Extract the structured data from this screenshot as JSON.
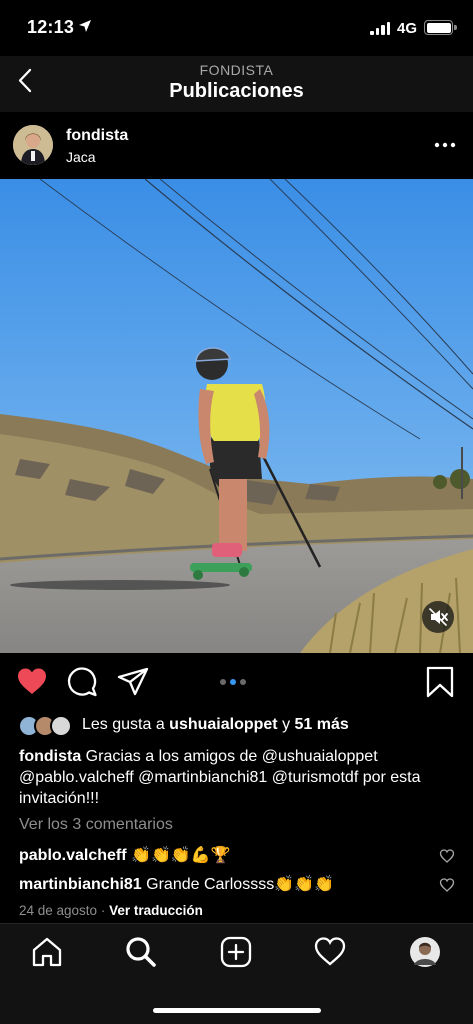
{
  "status_bar": {
    "time": "12:13",
    "network": "4G",
    "battery_percent": 100
  },
  "nav": {
    "subtitle": "FONDISTA",
    "title": "Publicaciones"
  },
  "post": {
    "username": "fondista",
    "location": "Jaca",
    "liked": true,
    "carousel": {
      "count": 3,
      "active_index": 1
    },
    "likes": {
      "prefix": "Les gusta a ",
      "first_user": "ushuaialoppet",
      "joiner": " y ",
      "others": "51 más"
    },
    "caption": {
      "author": "fondista",
      "text": "Gracias a los amigos de @ushuaialoppet @pablo.valcheff @martinbianchi81 @turismotdf por esta invitación!!!"
    },
    "view_comments": "Ver los 3 comentarios",
    "comments": [
      {
        "user": "pablo.valcheff",
        "text": "👏👏👏💪🏆"
      },
      {
        "user": "martinbianchi81",
        "text": "Grande Carlossss👏👏👏"
      }
    ],
    "date": "24 de agosto",
    "separator": "·",
    "translate_label": "Ver traducción"
  },
  "icons": {
    "back": "chevron-left-icon",
    "more": "more-dots-icon",
    "like": "heart-icon",
    "comment": "comment-icon",
    "share": "send-icon",
    "save": "bookmark-icon",
    "mute": "speaker-muted-icon",
    "home": "home-icon",
    "search": "search-icon",
    "create": "add-post-icon",
    "activity": "heart-outline-icon",
    "profile": "profile-avatar"
  },
  "colors": {
    "like_red": "#ed4956",
    "active_dot": "#3897f0",
    "background": "#000000",
    "header_bg": "#121212"
  }
}
